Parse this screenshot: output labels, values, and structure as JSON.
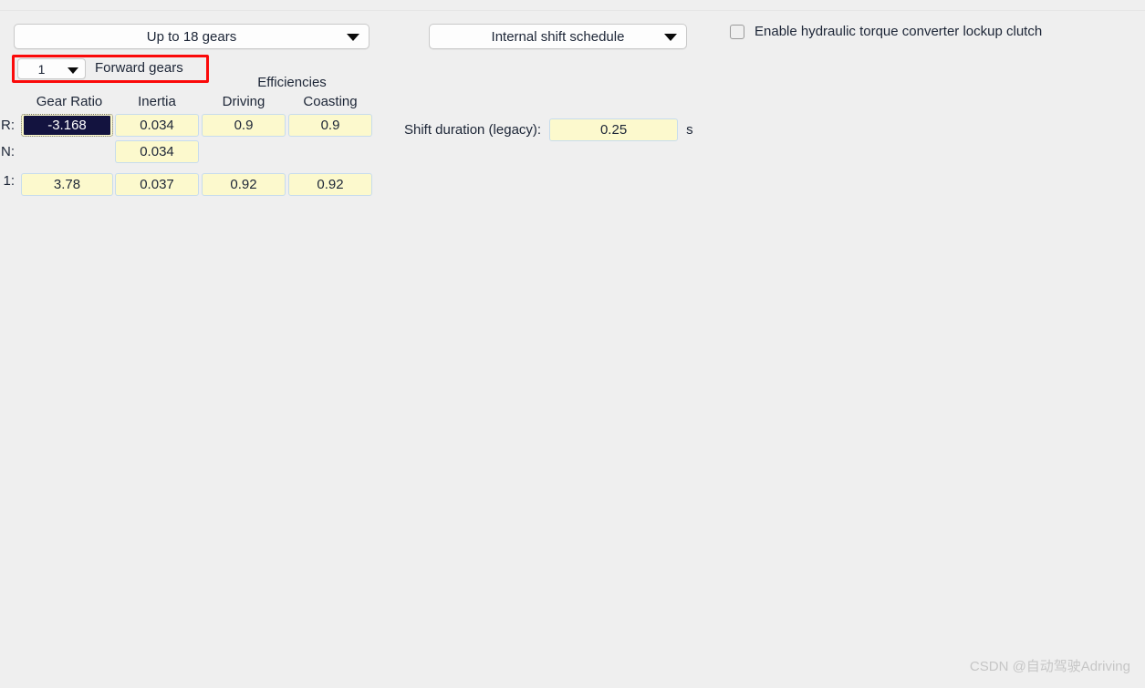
{
  "panel": {
    "gears_dropdown": {
      "value": "Up to 18 gears",
      "icon": "chevron-down-icon"
    },
    "forward_gears": {
      "count": "1",
      "label": "Forward gears",
      "icon": "chevron-down-icon",
      "highlight_color": "#fb0a0a"
    },
    "shift_schedule_dropdown": {
      "value": "Internal shift schedule",
      "icon": "chevron-down-icon"
    },
    "lockup_clutch": {
      "label": "Enable hydraulic torque converter lockup clutch",
      "checked": false
    },
    "shift_duration": {
      "label": "Shift duration (legacy):",
      "value": "0.25",
      "unit": "s"
    }
  },
  "gear_table": {
    "group_header": "Efficiencies",
    "columns": [
      "Gear Ratio",
      "Inertia",
      "Driving",
      "Coasting"
    ],
    "rows": [
      {
        "label": "R:",
        "gear_ratio": "-3.168",
        "inertia": "0.034",
        "driving": "0.9",
        "coasting": "0.9",
        "selected_cell": "gear_ratio"
      },
      {
        "label": "N:",
        "gear_ratio": "",
        "inertia": "0.034",
        "driving": "",
        "coasting": ""
      },
      {
        "label": "1:",
        "gear_ratio": "3.78",
        "inertia": "0.037",
        "driving": "0.92",
        "coasting": "0.92"
      }
    ]
  },
  "watermark": {
    "text": "CSDN @自动驾驶Adriving"
  },
  "colors": {
    "background": "#efefef",
    "field_fill": "#fcf9cd",
    "field_border": "#c7dced",
    "selection": "#13133f",
    "highlight": "#fb0a0a"
  }
}
